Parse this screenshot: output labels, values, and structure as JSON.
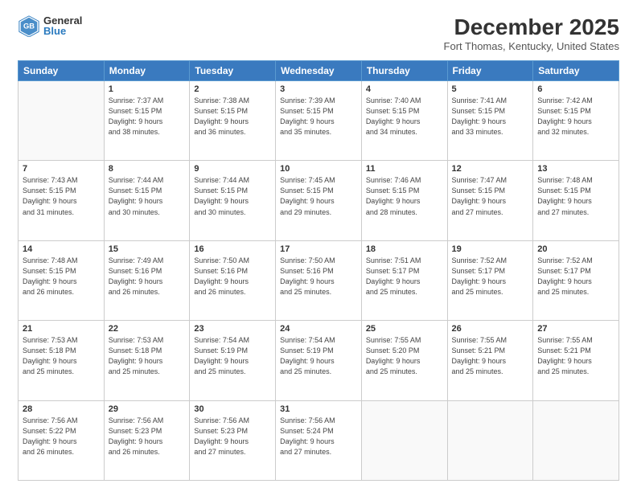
{
  "header": {
    "logo_general": "General",
    "logo_blue": "Blue",
    "month_title": "December 2025",
    "location": "Fort Thomas, Kentucky, United States"
  },
  "days_of_week": [
    "Sunday",
    "Monday",
    "Tuesday",
    "Wednesday",
    "Thursday",
    "Friday",
    "Saturday"
  ],
  "weeks": [
    [
      {
        "day": "",
        "info": ""
      },
      {
        "day": "1",
        "info": "Sunrise: 7:37 AM\nSunset: 5:15 PM\nDaylight: 9 hours\nand 38 minutes."
      },
      {
        "day": "2",
        "info": "Sunrise: 7:38 AM\nSunset: 5:15 PM\nDaylight: 9 hours\nand 36 minutes."
      },
      {
        "day": "3",
        "info": "Sunrise: 7:39 AM\nSunset: 5:15 PM\nDaylight: 9 hours\nand 35 minutes."
      },
      {
        "day": "4",
        "info": "Sunrise: 7:40 AM\nSunset: 5:15 PM\nDaylight: 9 hours\nand 34 minutes."
      },
      {
        "day": "5",
        "info": "Sunrise: 7:41 AM\nSunset: 5:15 PM\nDaylight: 9 hours\nand 33 minutes."
      },
      {
        "day": "6",
        "info": "Sunrise: 7:42 AM\nSunset: 5:15 PM\nDaylight: 9 hours\nand 32 minutes."
      }
    ],
    [
      {
        "day": "7",
        "info": "Sunrise: 7:43 AM\nSunset: 5:15 PM\nDaylight: 9 hours\nand 31 minutes."
      },
      {
        "day": "8",
        "info": "Sunrise: 7:44 AM\nSunset: 5:15 PM\nDaylight: 9 hours\nand 30 minutes."
      },
      {
        "day": "9",
        "info": "Sunrise: 7:44 AM\nSunset: 5:15 PM\nDaylight: 9 hours\nand 30 minutes."
      },
      {
        "day": "10",
        "info": "Sunrise: 7:45 AM\nSunset: 5:15 PM\nDaylight: 9 hours\nand 29 minutes."
      },
      {
        "day": "11",
        "info": "Sunrise: 7:46 AM\nSunset: 5:15 PM\nDaylight: 9 hours\nand 28 minutes."
      },
      {
        "day": "12",
        "info": "Sunrise: 7:47 AM\nSunset: 5:15 PM\nDaylight: 9 hours\nand 27 minutes."
      },
      {
        "day": "13",
        "info": "Sunrise: 7:48 AM\nSunset: 5:15 PM\nDaylight: 9 hours\nand 27 minutes."
      }
    ],
    [
      {
        "day": "14",
        "info": "Sunrise: 7:48 AM\nSunset: 5:15 PM\nDaylight: 9 hours\nand 26 minutes."
      },
      {
        "day": "15",
        "info": "Sunrise: 7:49 AM\nSunset: 5:16 PM\nDaylight: 9 hours\nand 26 minutes."
      },
      {
        "day": "16",
        "info": "Sunrise: 7:50 AM\nSunset: 5:16 PM\nDaylight: 9 hours\nand 26 minutes."
      },
      {
        "day": "17",
        "info": "Sunrise: 7:50 AM\nSunset: 5:16 PM\nDaylight: 9 hours\nand 25 minutes."
      },
      {
        "day": "18",
        "info": "Sunrise: 7:51 AM\nSunset: 5:17 PM\nDaylight: 9 hours\nand 25 minutes."
      },
      {
        "day": "19",
        "info": "Sunrise: 7:52 AM\nSunset: 5:17 PM\nDaylight: 9 hours\nand 25 minutes."
      },
      {
        "day": "20",
        "info": "Sunrise: 7:52 AM\nSunset: 5:17 PM\nDaylight: 9 hours\nand 25 minutes."
      }
    ],
    [
      {
        "day": "21",
        "info": "Sunrise: 7:53 AM\nSunset: 5:18 PM\nDaylight: 9 hours\nand 25 minutes."
      },
      {
        "day": "22",
        "info": "Sunrise: 7:53 AM\nSunset: 5:18 PM\nDaylight: 9 hours\nand 25 minutes."
      },
      {
        "day": "23",
        "info": "Sunrise: 7:54 AM\nSunset: 5:19 PM\nDaylight: 9 hours\nand 25 minutes."
      },
      {
        "day": "24",
        "info": "Sunrise: 7:54 AM\nSunset: 5:19 PM\nDaylight: 9 hours\nand 25 minutes."
      },
      {
        "day": "25",
        "info": "Sunrise: 7:55 AM\nSunset: 5:20 PM\nDaylight: 9 hours\nand 25 minutes."
      },
      {
        "day": "26",
        "info": "Sunrise: 7:55 AM\nSunset: 5:21 PM\nDaylight: 9 hours\nand 25 minutes."
      },
      {
        "day": "27",
        "info": "Sunrise: 7:55 AM\nSunset: 5:21 PM\nDaylight: 9 hours\nand 25 minutes."
      }
    ],
    [
      {
        "day": "28",
        "info": "Sunrise: 7:56 AM\nSunset: 5:22 PM\nDaylight: 9 hours\nand 26 minutes."
      },
      {
        "day": "29",
        "info": "Sunrise: 7:56 AM\nSunset: 5:23 PM\nDaylight: 9 hours\nand 26 minutes."
      },
      {
        "day": "30",
        "info": "Sunrise: 7:56 AM\nSunset: 5:23 PM\nDaylight: 9 hours\nand 27 minutes."
      },
      {
        "day": "31",
        "info": "Sunrise: 7:56 AM\nSunset: 5:24 PM\nDaylight: 9 hours\nand 27 minutes."
      },
      {
        "day": "",
        "info": ""
      },
      {
        "day": "",
        "info": ""
      },
      {
        "day": "",
        "info": ""
      }
    ]
  ]
}
